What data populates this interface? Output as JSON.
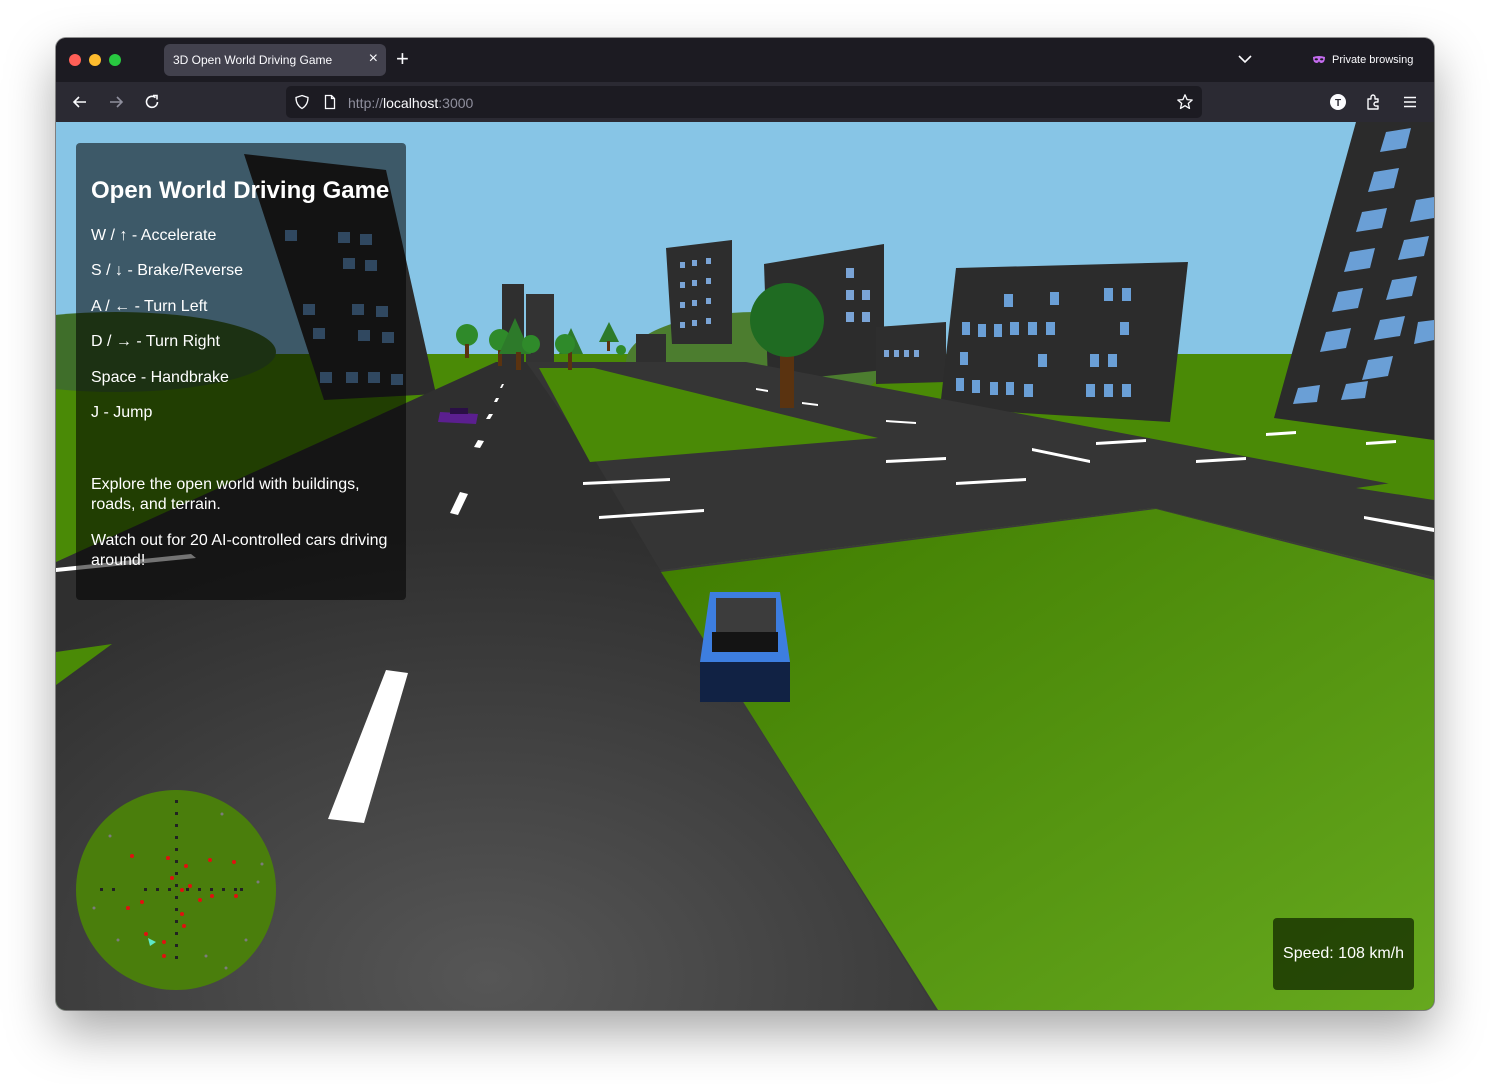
{
  "browser": {
    "tab_title": "3D Open World Driving Game",
    "tab_close": "×",
    "new_tab": "+",
    "private_label": "Private browsing",
    "url_protocol": "http://",
    "url_host": "localhost",
    "url_port": ":3000"
  },
  "game": {
    "title": "Open World Driving Game",
    "controls": [
      "W / ↑ - Accelerate",
      "S / ↓ - Brake/Reverse",
      "A / ← - Turn Left",
      "D / → - Turn Right",
      "Space - Handbrake",
      "J - Jump"
    ],
    "notes": [
      "Explore the open world with buildings, roads, and terrain.",
      "Watch out for 20 AI-controlled cars driving around!"
    ],
    "speed_text": "Speed: 108 km/h"
  },
  "colors": {
    "sky": "#87c5e6",
    "grass": "#4e8a08",
    "road": "#3a3a3a",
    "building": "#2b2b2b",
    "window": "#6d9fd4",
    "player_car": "#3d7ee0",
    "ai_car": "#5b1f8f"
  }
}
